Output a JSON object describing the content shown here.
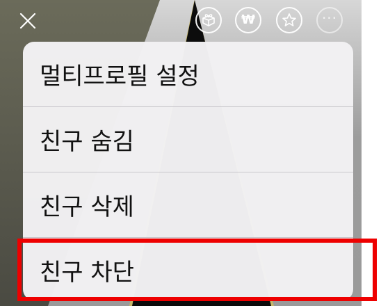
{
  "topbar": {
    "close_icon": "close-icon",
    "buttons": [
      {
        "name": "gift-icon"
      },
      {
        "name": "won-icon",
        "glyph": "₩"
      },
      {
        "name": "star-icon"
      },
      {
        "name": "more-icon",
        "glyph": "···"
      }
    ]
  },
  "menu": {
    "items": [
      {
        "label": "멀티프로필 설정"
      },
      {
        "label": "친구 숨김"
      },
      {
        "label": "친구 삭제"
      },
      {
        "label": "친구 차단"
      }
    ]
  },
  "highlight": {
    "color": "#ee0000",
    "target": "친구 차단"
  }
}
